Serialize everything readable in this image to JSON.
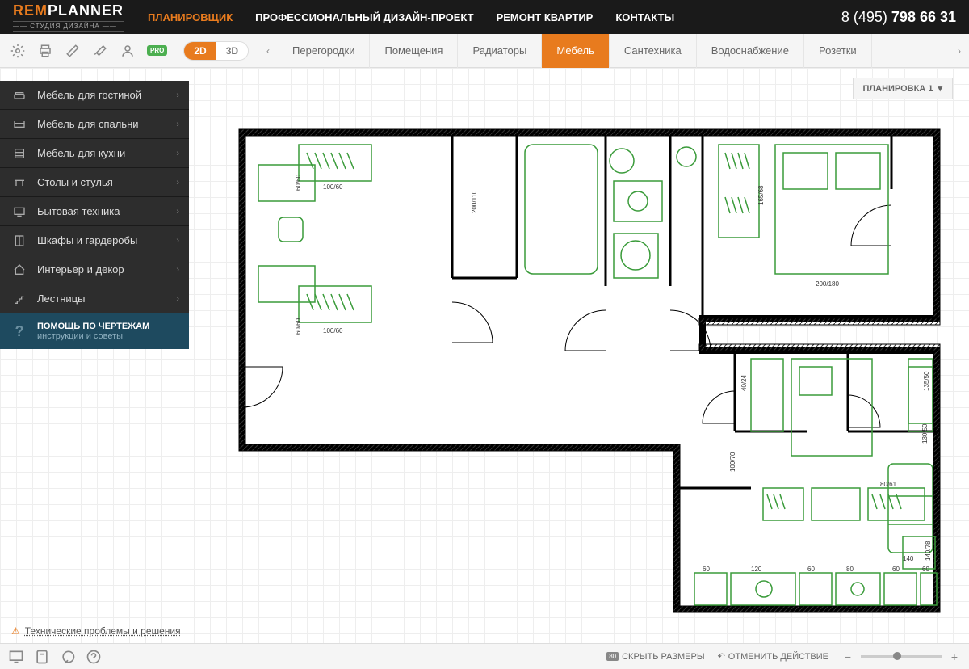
{
  "logo": {
    "rem": "REM",
    "planner": "PLANNER",
    "sub": "—— СТУДИЯ ДИЗАЙНА ——"
  },
  "nav": [
    {
      "label": "ПЛАНИРОВЩИК",
      "active": true
    },
    {
      "label": "ПРОФЕССИОНАЛЬНЫЙ ДИЗАЙН-ПРОЕКТ",
      "active": false
    },
    {
      "label": "РЕМОНТ КВАРТИР",
      "active": false
    },
    {
      "label": "КОНТАКТЫ",
      "active": false
    }
  ],
  "phone": {
    "prefix": "8 (495) ",
    "number": "798 66 31"
  },
  "toolbar": {
    "pro": "PRO",
    "view2d": "2D",
    "view3d": "3D"
  },
  "tabs": [
    {
      "label": "Перегородки",
      "active": false
    },
    {
      "label": "Помещения",
      "active": false
    },
    {
      "label": "Радиаторы",
      "active": false
    },
    {
      "label": "Мебель",
      "active": true
    },
    {
      "label": "Сантехника",
      "active": false
    },
    {
      "label": "Водоснабжение",
      "active": false
    },
    {
      "label": "Розетки",
      "active": false
    }
  ],
  "sidebar": {
    "items": [
      {
        "label": "Мебель для гостиной"
      },
      {
        "label": "Мебель для спальни"
      },
      {
        "label": "Мебель для кухни"
      },
      {
        "label": "Столы и стулья"
      },
      {
        "label": "Бытовая техника"
      },
      {
        "label": "Шкафы и гардеробы"
      },
      {
        "label": "Интерьер и декор"
      },
      {
        "label": "Лестницы"
      }
    ],
    "help": {
      "title": "ПОМОЩЬ ПО ЧЕРТЕЖАМ",
      "sub": "инструкции и советы"
    }
  },
  "plan_label": "ПЛАНИРОВКА 1",
  "dimensions": {
    "d1": "100/60",
    "d2": "100/60",
    "d3": "200/110",
    "d4": "200/180",
    "d5": "165/68",
    "d6": "60/60",
    "d7": "60/60",
    "d8": "40/24",
    "d9": "100/70",
    "d10": "135/50",
    "d11": "130/50",
    "d12": "80/61",
    "d13": "140",
    "d14": "140/78",
    "d15": "60",
    "d16": "120",
    "d17": "60",
    "d18": "80",
    "d19": "60",
    "d20": "60"
  },
  "footer_link": "Технические проблемы и решения",
  "bottom": {
    "hide_dims": "СКРЫТЬ РАЗМЕРЫ",
    "hide_badge": "80",
    "undo": "ОТМЕНИТЬ ДЕЙСТВИЕ"
  }
}
